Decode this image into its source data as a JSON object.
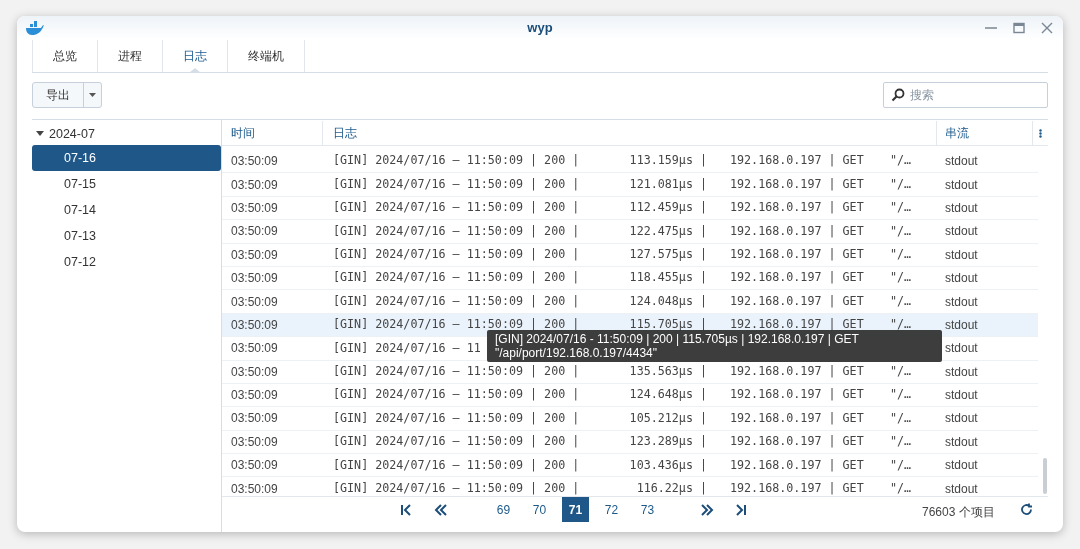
{
  "window": {
    "title": "wyp"
  },
  "tabs": [
    {
      "label": "总览",
      "selected": false
    },
    {
      "label": "进程",
      "selected": false
    },
    {
      "label": "日志",
      "selected": true
    },
    {
      "label": "终端机",
      "selected": false
    }
  ],
  "toolbar": {
    "export_button": "导出",
    "search": {
      "placeholder": "搜索"
    }
  },
  "sidebar": {
    "items": [
      {
        "label": "2024-07",
        "expanded": true,
        "children": [
          {
            "label": "07-16",
            "selected": true
          },
          {
            "label": "07-15",
            "selected": false
          },
          {
            "label": "07-14",
            "selected": false
          },
          {
            "label": "07-13",
            "selected": false
          },
          {
            "label": "07-12",
            "selected": false
          }
        ]
      }
    ]
  },
  "table": {
    "columns": [
      "时间",
      "日志",
      "串流"
    ],
    "rows": [
      {
        "time": "03:50:09",
        "log": [
          "[GIN] 2024/07/16 – 11:50:09 | 200 |",
          "113.159µs |",
          "192.168.0.197 | GET",
          "\"/…"
        ],
        "stream": "stdout",
        "hovered": false
      },
      {
        "time": "03:50:09",
        "log": [
          "[GIN] 2024/07/16 – 11:50:09 | 200 |",
          "121.081µs |",
          "192.168.0.197 | GET",
          "\"/…"
        ],
        "stream": "stdout",
        "hovered": false
      },
      {
        "time": "03:50:09",
        "log": [
          "[GIN] 2024/07/16 – 11:50:09 | 200 |",
          "112.459µs |",
          "192.168.0.197 | GET",
          "\"/…"
        ],
        "stream": "stdout",
        "hovered": false
      },
      {
        "time": "03:50:09",
        "log": [
          "[GIN] 2024/07/16 – 11:50:09 | 200 |",
          "122.475µs |",
          "192.168.0.197 | GET",
          "\"/…"
        ],
        "stream": "stdout",
        "hovered": false
      },
      {
        "time": "03:50:09",
        "log": [
          "[GIN] 2024/07/16 – 11:50:09 | 200 |",
          "127.575µs |",
          "192.168.0.197 | GET",
          "\"/…"
        ],
        "stream": "stdout",
        "hovered": false
      },
      {
        "time": "03:50:09",
        "log": [
          "[GIN] 2024/07/16 – 11:50:09 | 200 |",
          "118.455µs |",
          "192.168.0.197 | GET",
          "\"/…"
        ],
        "stream": "stdout",
        "hovered": false
      },
      {
        "time": "03:50:09",
        "log": [
          "[GIN] 2024/07/16 – 11:50:09 | 200 |",
          "124.048µs |",
          "192.168.0.197 | GET",
          "\"/…"
        ],
        "stream": "stdout",
        "hovered": false
      },
      {
        "time": "03:50:09",
        "log": [
          "[GIN] 2024/07/16 – 11:50:09 | 200 |",
          "115.705µs |",
          "192.168.0.197 | GET",
          "\"/…"
        ],
        "stream": "stdout",
        "hovered": true
      },
      {
        "time": "03:50:09",
        "log": [
          "[GIN] 2024/07/16 – 11"
        ],
        "stream": "stdout",
        "hovered": false
      },
      {
        "time": "03:50:09",
        "log": [
          "[GIN] 2024/07/16 – 11:50:09 | 200 |",
          "135.563µs |",
          "192.168.0.197 | GET",
          "\"/…"
        ],
        "stream": "stdout",
        "hovered": false
      },
      {
        "time": "03:50:09",
        "log": [
          "[GIN] 2024/07/16 – 11:50:09 | 200 |",
          "124.648µs |",
          "192.168.0.197 | GET",
          "\"/…"
        ],
        "stream": "stdout",
        "hovered": false
      },
      {
        "time": "03:50:09",
        "log": [
          "[GIN] 2024/07/16 – 11:50:09 | 200 |",
          "105.212µs |",
          "192.168.0.197 | GET",
          "\"/…"
        ],
        "stream": "stdout",
        "hovered": false
      },
      {
        "time": "03:50:09",
        "log": [
          "[GIN] 2024/07/16 – 11:50:09 | 200 |",
          "123.289µs |",
          "192.168.0.197 | GET",
          "\"/…"
        ],
        "stream": "stdout",
        "hovered": false
      },
      {
        "time": "03:50:09",
        "log": [
          "[GIN] 2024/07/16 – 11:50:09 | 200 |",
          "103.436µs |",
          "192.168.0.197 | GET",
          "\"/…"
        ],
        "stream": "stdout",
        "hovered": false
      },
      {
        "time": "03:50:09",
        "log": [
          "[GIN] 2024/07/16 – 11:50:09 | 200 |",
          "116.22µs |",
          "192.168.0.197 | GET",
          "\"/…"
        ],
        "stream": "stdout",
        "hovered": false
      }
    ],
    "tooltip": [
      "[GIN] 2024/07/16 - 11:50:09 | 200 | 115.705µs | 192.168.0.197 | GET",
      "\"/api/port/192.168.0.197/4434\""
    ]
  },
  "pagination": {
    "pages": [
      {
        "label": "69",
        "selected": false
      },
      {
        "label": "70",
        "selected": false
      },
      {
        "label": "71",
        "selected": true
      },
      {
        "label": "72",
        "selected": false
      },
      {
        "label": "73",
        "selected": false
      }
    ],
    "total": "76603 个项目"
  }
}
